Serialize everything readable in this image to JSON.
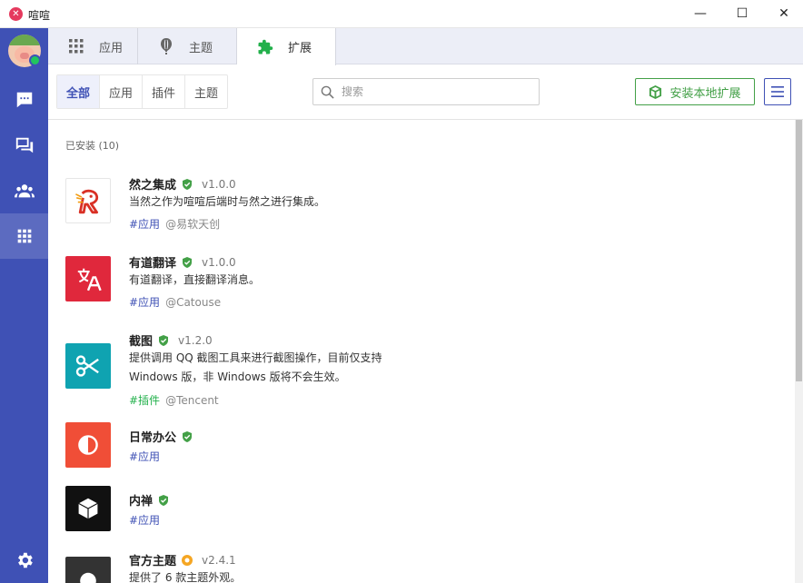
{
  "window": {
    "title": "喧喧",
    "logo_icon": "xuanxuan-logo-icon",
    "minimize": "—",
    "maximize": "☐",
    "close": "✕"
  },
  "sidebar": {
    "avatar": "user-avatar",
    "status": "online",
    "items": [
      {
        "name": "chat-icon",
        "active": false
      },
      {
        "name": "conversations-icon",
        "active": false
      },
      {
        "name": "contacts-icon",
        "active": false
      },
      {
        "name": "apps-grid-icon",
        "active": true
      }
    ],
    "bottom": "settings-gear-icon"
  },
  "tabs": [
    {
      "label": "应用",
      "icon": "grid-icon",
      "active": false
    },
    {
      "label": "主题",
      "icon": "balloon-icon",
      "active": false
    },
    {
      "label": "扩展",
      "icon": "puzzle-icon",
      "active": true
    }
  ],
  "filters": [
    {
      "label": "全部",
      "active": true
    },
    {
      "label": "应用",
      "active": false
    },
    {
      "label": "插件",
      "active": false
    },
    {
      "label": "主题",
      "active": false
    }
  ],
  "search": {
    "placeholder": "搜索",
    "value": ""
  },
  "install_button": "安装本地扩展",
  "section_title": "已安装 (10)",
  "extensions": [
    {
      "name": "然之集成",
      "version": "v1.0.0",
      "badge": "verified-green",
      "desc": [
        "当然之作为喧喧后端时与然之进行集成。"
      ],
      "tag": "#应用",
      "tag_color": "blue",
      "author": "@易软天创"
    },
    {
      "name": "有道翻译",
      "version": "v1.0.0",
      "badge": "verified-green",
      "desc": [
        "有道翻译，直接翻译消息。"
      ],
      "tag": "#应用",
      "tag_color": "blue",
      "author": "@Catouse"
    },
    {
      "name": "截图",
      "version": "v1.2.0",
      "badge": "verified-green",
      "desc": [
        "提供调用 QQ 截图工具来进行截图操作，目前仅支持",
        "Windows 版，非 Windows 版将不会生效。"
      ],
      "tag": "#插件",
      "tag_color": "green",
      "author": "@Tencent"
    },
    {
      "name": "日常办公",
      "version": "",
      "badge": "verified-green",
      "desc": [],
      "tag": "#应用",
      "tag_color": "blue",
      "author": ""
    },
    {
      "name": "内禅",
      "version": "",
      "badge": "verified-green",
      "desc": [],
      "tag": "#应用",
      "tag_color": "blue",
      "author": ""
    },
    {
      "name": "官方主题",
      "version": "v2.4.1",
      "badge": "official-orange",
      "desc": [
        "提供了 6 款主题外观。"
      ],
      "tag": "",
      "tag_color": "blue",
      "author": ""
    }
  ],
  "colors": {
    "sidebar": "#3f51b5",
    "accent": "#3f51b5",
    "install_green": "#43a047",
    "verified_green": "#43a047",
    "official_orange": "#f5a623"
  }
}
